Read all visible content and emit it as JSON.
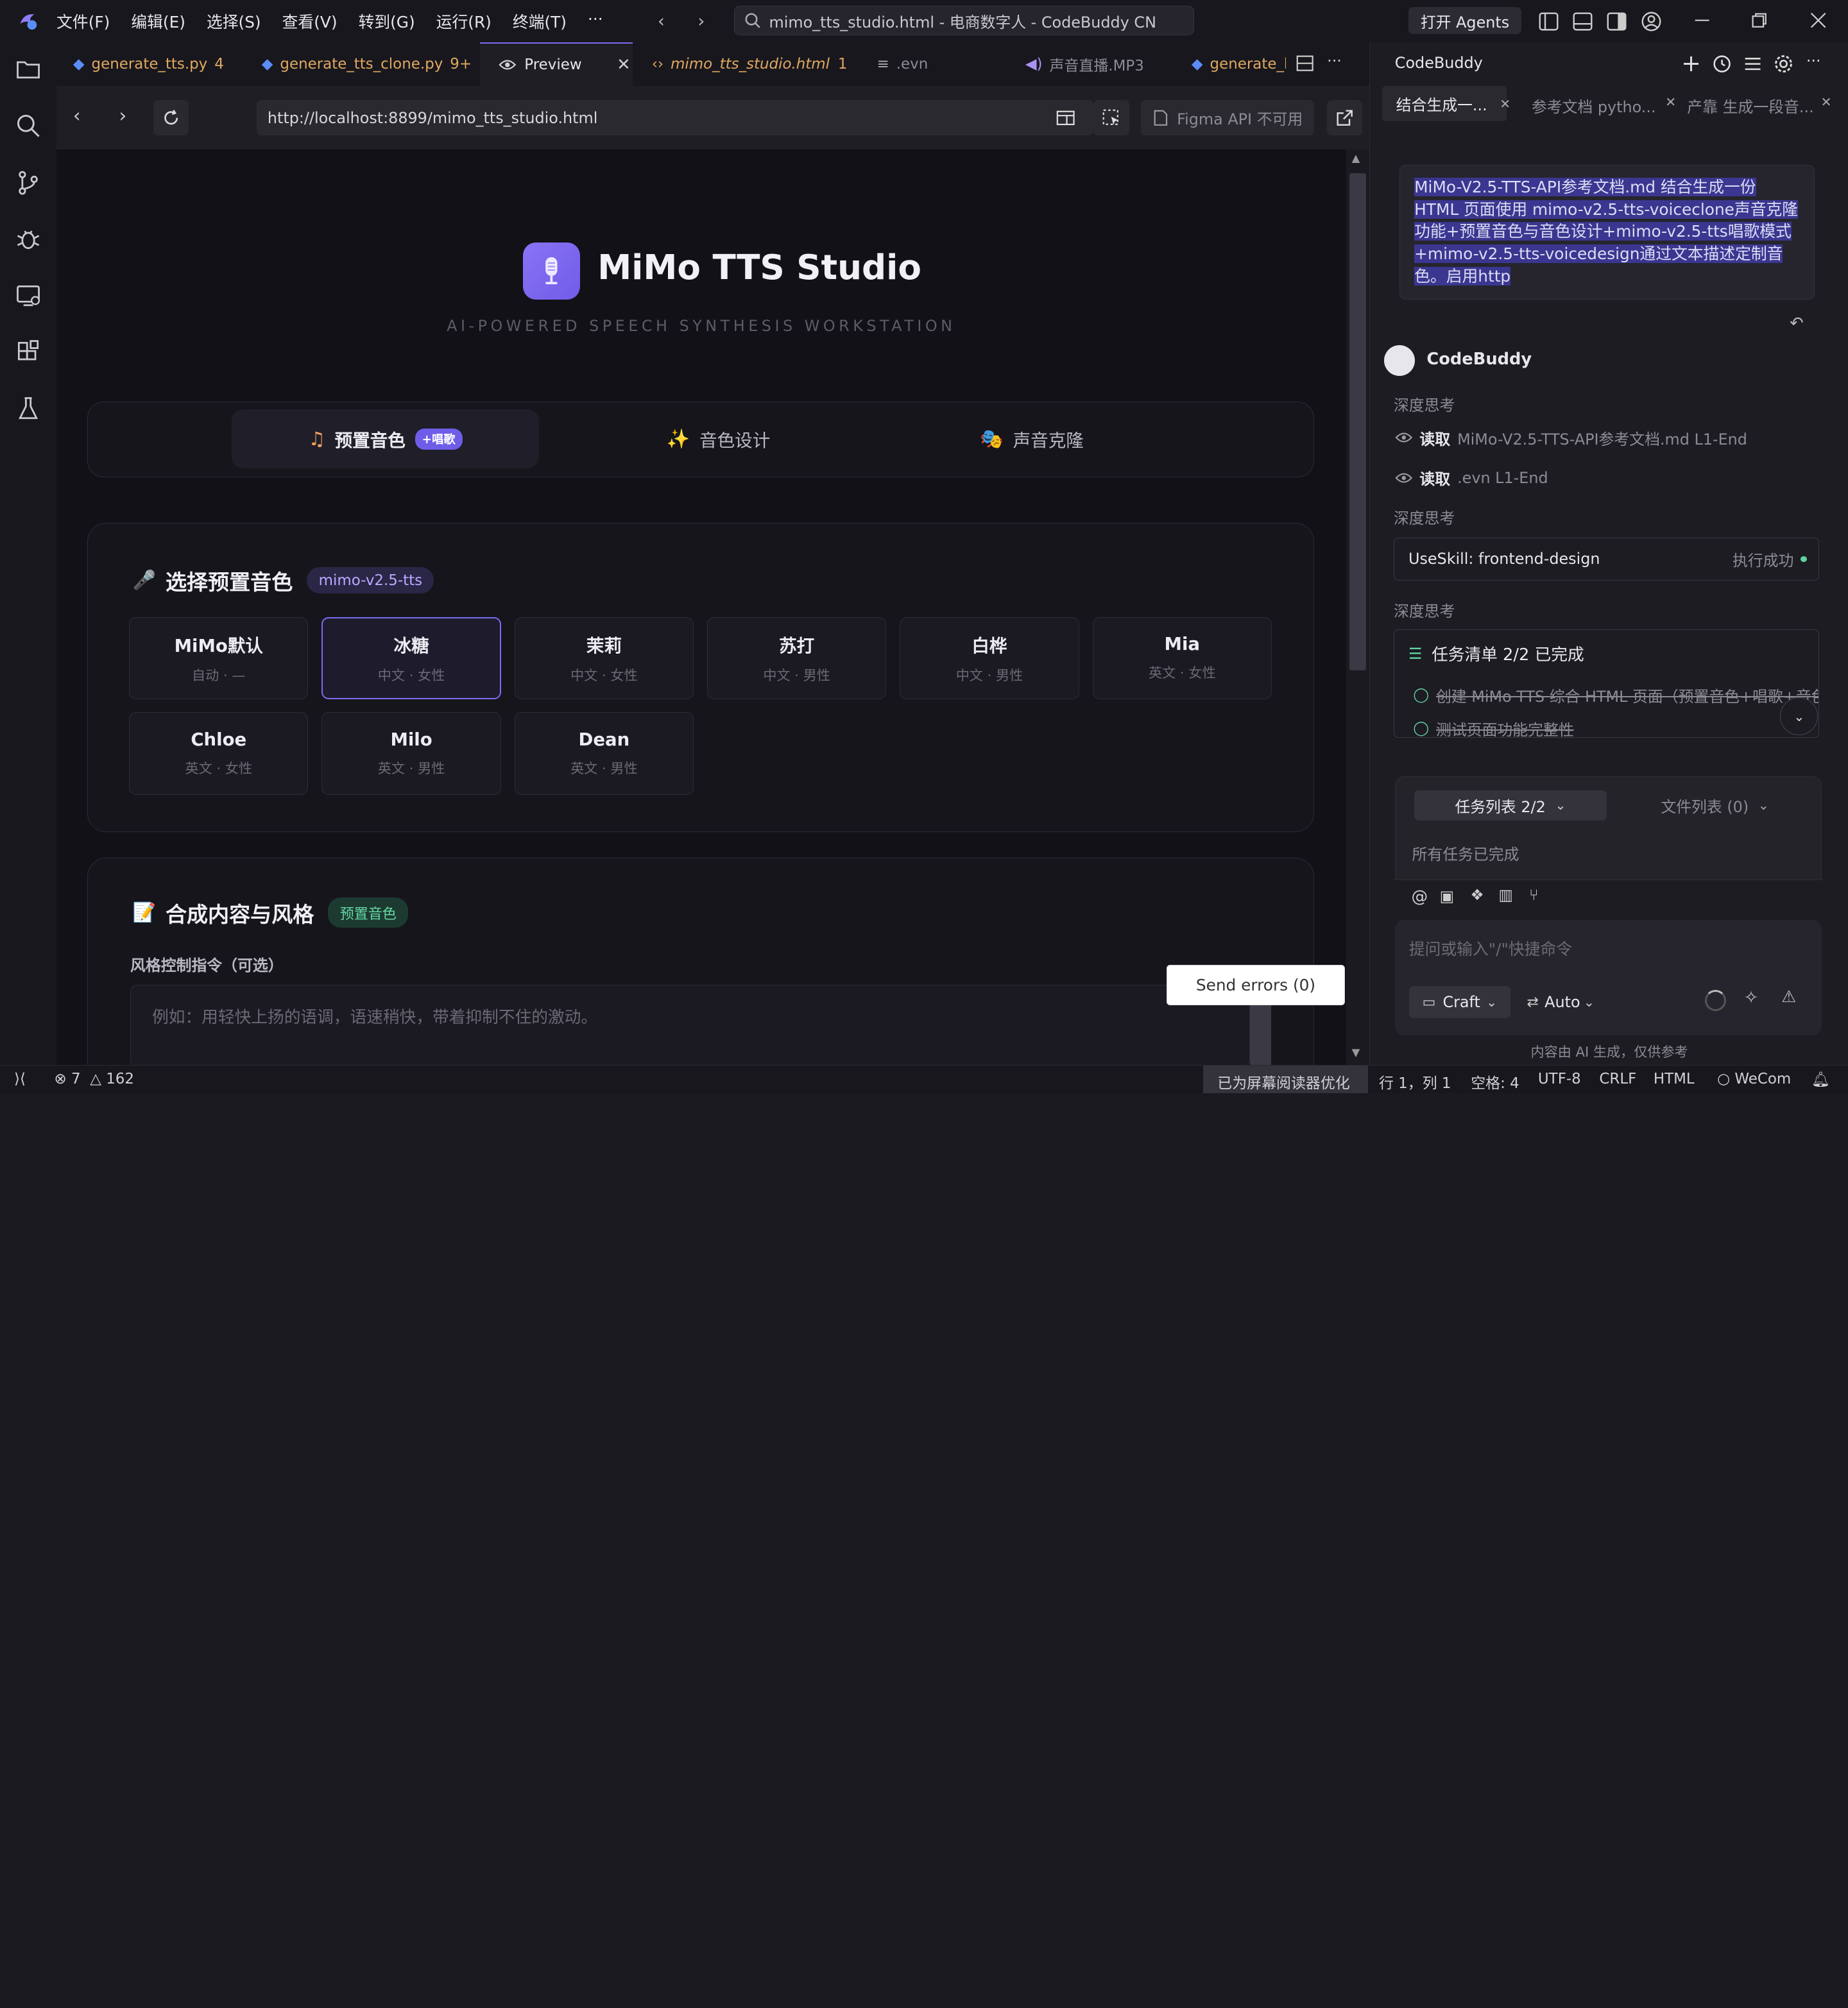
{
  "menu": [
    "文件(F)",
    "编辑(E)",
    "选择(S)",
    "查看(V)",
    "转到(G)",
    "运行(R)",
    "终端(T)",
    "···"
  ],
  "window_title": "mimo_tts_studio.html - 电商数字人 - CodeBuddy CN",
  "agents_button": "打开 Agents",
  "tabs": [
    {
      "label": "generate_tts.py",
      "badge": "4"
    },
    {
      "label": "generate_tts_clone.py",
      "badge": "9+"
    },
    {
      "label": "Preview",
      "badge": ""
    },
    {
      "label": "mimo_tts_studio.html",
      "badge": "1"
    },
    {
      "label": ".evn",
      "badge": ""
    },
    {
      "label": "声音直播.MP3",
      "badge": ""
    },
    {
      "label": "generate_k",
      "badge": ""
    }
  ],
  "browser": {
    "url": "http://localhost:8899/mimo_tts_studio.html",
    "figma": "Figma API 不可用"
  },
  "app": {
    "title": "MiMo TTS Studio",
    "subtitle": "AI-POWERED SPEECH SYNTHESIS WORKSTATION",
    "mode_tabs": [
      {
        "label": "预置音色",
        "badge": "+唱歌"
      },
      {
        "label": "音色设计",
        "badge": ""
      },
      {
        "label": "声音克隆",
        "badge": ""
      }
    ],
    "preset_section": {
      "title": "选择预置音色",
      "model": "mimo-v2.5-tts"
    },
    "voices": [
      {
        "name": "MiMo默认",
        "meta": "自动 · —",
        "selected": false
      },
      {
        "name": "冰糖",
        "meta": "中文 · 女性",
        "selected": true
      },
      {
        "name": "茉莉",
        "meta": "中文 · 女性",
        "selected": false
      },
      {
        "name": "苏打",
        "meta": "中文 · 男性",
        "selected": false
      },
      {
        "name": "白桦",
        "meta": "中文 · 男性",
        "selected": false
      },
      {
        "name": "Mia",
        "meta": "英文 · 女性",
        "selected": false
      },
      {
        "name": "Chloe",
        "meta": "英文 · 女性",
        "selected": false
      },
      {
        "name": "Milo",
        "meta": "英文 · 男性",
        "selected": false
      },
      {
        "name": "Dean",
        "meta": "英文 · 男性",
        "selected": false
      }
    ],
    "compose_section": {
      "title": "合成内容与风格",
      "badge": "预置音色",
      "style_label": "风格控制指令（可选）",
      "style_placeholder": "例如：用轻快上扬的语调，语速稍快，带着抑制不住的激动。"
    },
    "send_errors": "Send errors (0)"
  },
  "panel": {
    "title": "CodeBuddy",
    "chat_tabs": [
      "结合生成一...",
      "参考文档 pytho...",
      "产靠 生成一段音..."
    ],
    "user_msg": "MiMo-V2.5-TTS-API参考文档.md  结合生成一份HTML 页面使用 mimo-v2.5-tts-voiceclone声音克隆功能+预置音色与音色设计+mimo-v2.5-tts唱歌模式+mimo-v2.5-tts-voicedesign通过文本描述定制音色。启用http",
    "bot_name": "CodeBuddy",
    "deep_think": "深度思考",
    "read1": {
      "verb": "读取",
      "file": "MiMo-V2.5-TTS-API参考文档.md L1-End"
    },
    "read2": {
      "verb": "读取",
      "file": ".evn L1-End"
    },
    "skill": {
      "name": "UseSkill: frontend-design",
      "status": "执行成功"
    },
    "tasklist": {
      "title": "任务清单 2/2 已完成",
      "items": [
        "创建 MiMo TTS 综合 HTML 页面（预置音色+唱歌+音色",
        "测试页面功能完整性"
      ]
    },
    "summary_tabs": {
      "tasks": "任务列表 2/2",
      "files": "文件列表 (0)"
    },
    "all_done": "所有任务已完成",
    "input_placeholder": "提问或输入\"/\"快捷命令",
    "mode": "Craft",
    "model": "Auto",
    "footer": "内容由 AI 生成，仅供参考"
  },
  "statusbar": {
    "errors": "7",
    "warnings": "162",
    "a11y": "已为屏幕阅读器优化",
    "position": "行 1，列 1",
    "spaces": "空格: 4",
    "encoding": "UTF-8",
    "eol": "CRLF",
    "lang": "HTML",
    "wecom": "WeCom"
  },
  "colors": {
    "accent": "#7a6cf0",
    "bg": "#121117",
    "panel": "#1d1c22",
    "success": "#5fd3a0"
  }
}
